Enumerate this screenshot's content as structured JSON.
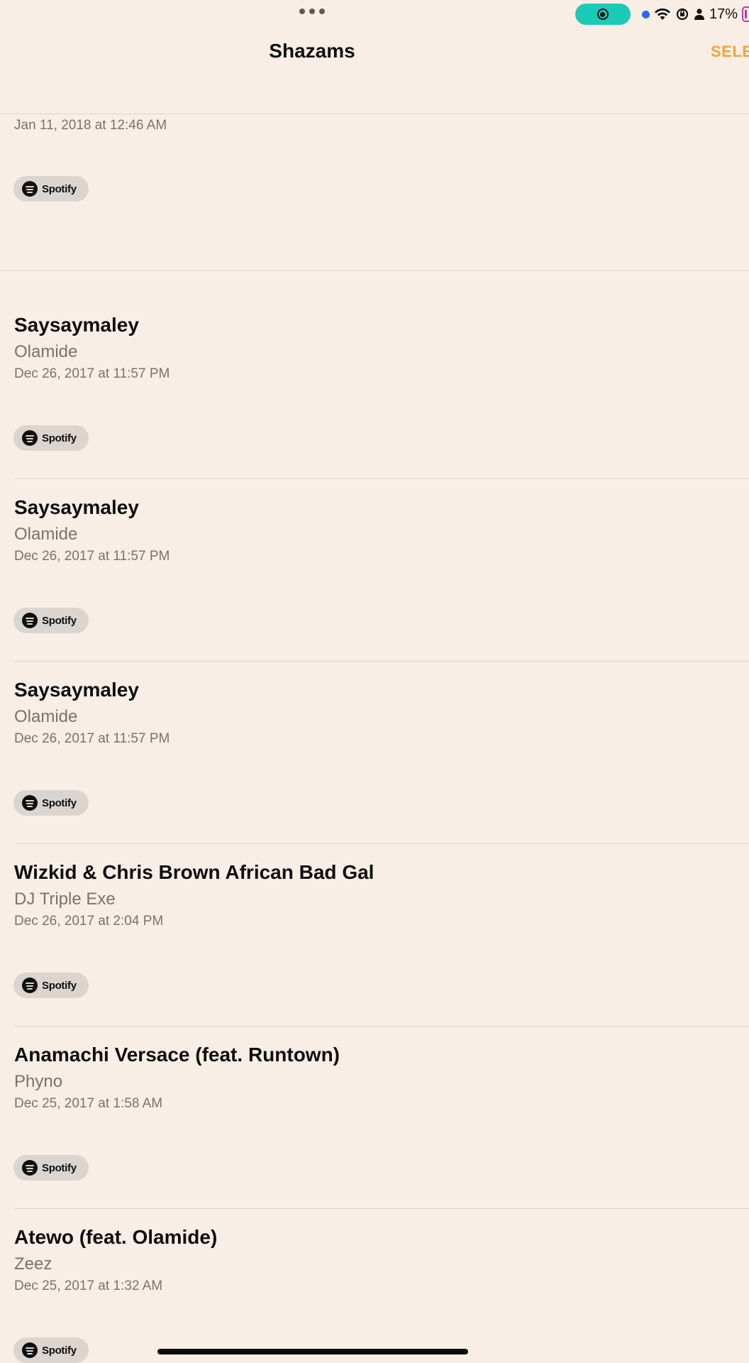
{
  "status_bar": {
    "battery_percent": "17%"
  },
  "nav": {
    "title": "Shazams",
    "select_label": "SELE"
  },
  "partial_row": {
    "date": "Jan 11, 2018 at 12:46 AM",
    "spotify_label": "Spotify"
  },
  "songs": [
    {
      "title": "Saysaymaley",
      "artist": "Olamide",
      "date": "Dec 26, 2017 at 11:57 PM",
      "spotify_label": "Spotify"
    },
    {
      "title": "Saysaymaley",
      "artist": "Olamide",
      "date": "Dec 26, 2017 at 11:57 PM",
      "spotify_label": "Spotify"
    },
    {
      "title": "Saysaymaley",
      "artist": "Olamide",
      "date": "Dec 26, 2017 at 11:57 PM",
      "spotify_label": "Spotify"
    },
    {
      "title": "Wizkid & Chris Brown African Bad Gal",
      "artist": "DJ Triple Exe",
      "date": "Dec 26, 2017 at 2:04 PM",
      "spotify_label": "Spotify"
    },
    {
      "title": "Anamachi Versace (feat. Runtown)",
      "artist": "Phyno",
      "date": "Dec 25, 2017 at 1:58 AM",
      "spotify_label": "Spotify"
    },
    {
      "title": "Atewo (feat. Olamide)",
      "artist": "Zeez",
      "date": "Dec 25, 2017 at 1:32 AM",
      "spotify_label": "Spotify"
    }
  ],
  "colors": {
    "background": "#f8eee6",
    "accent": "#f0a33b",
    "secondary_text": "#7a726c",
    "record_pill": "#1ccab8"
  }
}
